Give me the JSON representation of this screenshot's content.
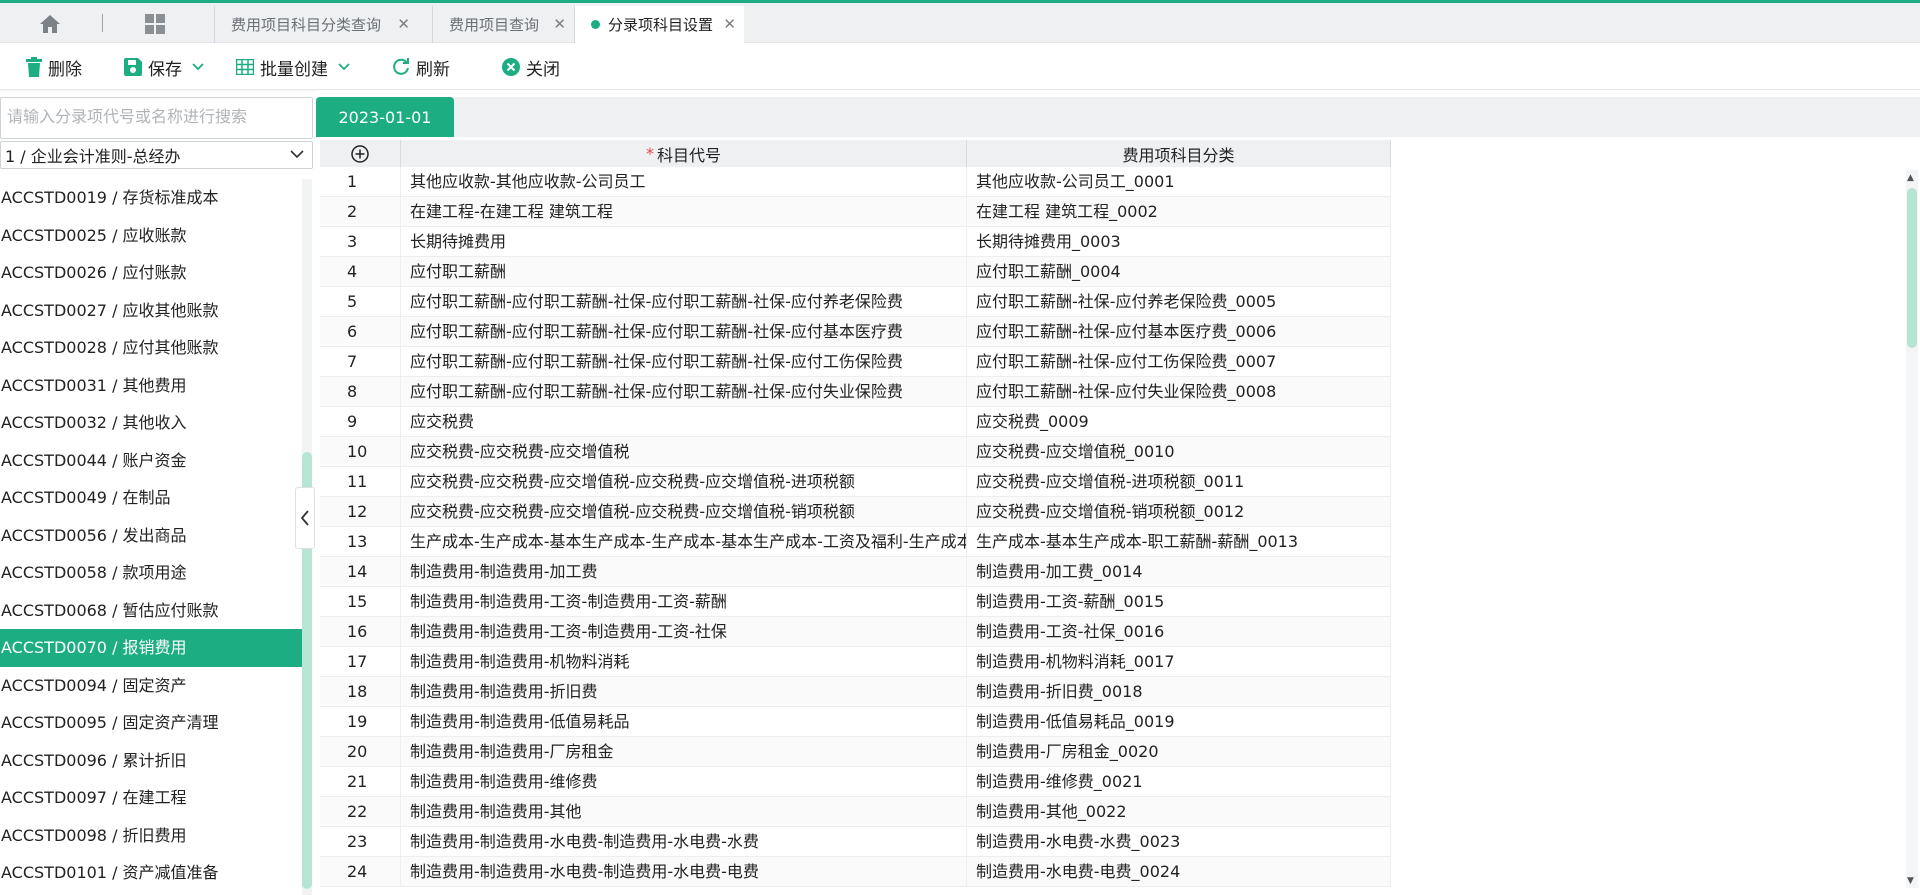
{
  "tabs": [
    {
      "label": "费用项目科目分类查询",
      "active": false
    },
    {
      "label": "费用项目查询",
      "active": false
    },
    {
      "label": "分录项科目设置",
      "active": true
    }
  ],
  "toolbar": {
    "delete_label": "删除",
    "save_label": "保存",
    "batch_create_label": "批量创建",
    "refresh_label": "刷新",
    "close_label": "关闭"
  },
  "sidebar": {
    "search_placeholder": "请输入分录项代号或名称进行搜索",
    "selected_ledger": "1 / 企业会计准则-总经办",
    "items": [
      "ACCSTD0019 / 存货标准成本",
      "ACCSTD0025 / 应收账款",
      "ACCSTD0026 / 应付账款",
      "ACCSTD0027 / 应收其他账款",
      "ACCSTD0028 / 应付其他账款",
      "ACCSTD0031 / 其他费用",
      "ACCSTD0032 / 其他收入",
      "ACCSTD0044 / 账户资金",
      "ACCSTD0049 / 在制品",
      "ACCSTD0056 / 发出商品",
      "ACCSTD0058 / 款项用途",
      "ACCSTD0068 / 暂估应付账款",
      "ACCSTD0070 / 报销费用",
      "ACCSTD0094 / 固定资产",
      "ACCSTD0095 / 固定资产清理",
      "ACCSTD0096 / 累计折旧",
      "ACCSTD0097 / 在建工程",
      "ACCSTD0098 / 折旧费用",
      "ACCSTD0101 / 资产减值准备"
    ],
    "selected_item": "ACCSTD0070 / 报销费用"
  },
  "date_tab": "2023-01-01",
  "table": {
    "columns": [
      "科目代号",
      "费用项科目分类"
    ],
    "required_marker": "*",
    "rows": [
      [
        "1",
        "其他应收款-其他应收款-公司员工",
        "其他应收款-公司员工_0001"
      ],
      [
        "2",
        "在建工程-在建工程 建筑工程",
        "在建工程 建筑工程_0002"
      ],
      [
        "3",
        "长期待摊费用",
        "长期待摊费用_0003"
      ],
      [
        "4",
        "应付职工薪酬",
        "应付职工薪酬_0004"
      ],
      [
        "5",
        "应付职工薪酬-应付职工薪酬-社保-应付职工薪酬-社保-应付养老保险费",
        "应付职工薪酬-社保-应付养老保险费_0005"
      ],
      [
        "6",
        "应付职工薪酬-应付职工薪酬-社保-应付职工薪酬-社保-应付基本医疗费",
        "应付职工薪酬-社保-应付基本医疗费_0006"
      ],
      [
        "7",
        "应付职工薪酬-应付职工薪酬-社保-应付职工薪酬-社保-应付工伤保险费",
        "应付职工薪酬-社保-应付工伤保险费_0007"
      ],
      [
        "8",
        "应付职工薪酬-应付职工薪酬-社保-应付职工薪酬-社保-应付失业保险费",
        "应付职工薪酬-社保-应付失业保险费_0008"
      ],
      [
        "9",
        "应交税费",
        "应交税费_0009"
      ],
      [
        "10",
        "应交税费-应交税费-应交增值税",
        "应交税费-应交增值税_0010"
      ],
      [
        "11",
        "应交税费-应交税费-应交增值税-应交税费-应交增值税-进项税额",
        "应交税费-应交增值税-进项税额_0011"
      ],
      [
        "12",
        "应交税费-应交税费-应交增值税-应交税费-应交增值税-销项税额",
        "应交税费-应交增值税-销项税额_0012"
      ],
      [
        "13",
        "生产成本-生产成本-基本生产成本-生产成本-基本生产成本-工资及福利-生产成本",
        "生产成本-基本生产成本-职工薪酬-薪酬_0013"
      ],
      [
        "14",
        "制造费用-制造费用-加工费",
        "制造费用-加工费_0014"
      ],
      [
        "15",
        "制造费用-制造费用-工资-制造费用-工资-薪酬",
        "制造费用-工资-薪酬_0015"
      ],
      [
        "16",
        "制造费用-制造费用-工资-制造费用-工资-社保",
        "制造费用-工资-社保_0016"
      ],
      [
        "17",
        "制造费用-制造费用-机物料消耗",
        "制造费用-机物料消耗_0017"
      ],
      [
        "18",
        "制造费用-制造费用-折旧费",
        "制造费用-折旧费_0018"
      ],
      [
        "19",
        "制造费用-制造费用-低值易耗品",
        "制造费用-低值易耗品_0019"
      ],
      [
        "20",
        "制造费用-制造费用-厂房租金",
        "制造费用-厂房租金_0020"
      ],
      [
        "21",
        "制造费用-制造费用-维修费",
        "制造费用-维修费_0021"
      ],
      [
        "22",
        "制造费用-制造费用-其他",
        "制造费用-其他_0022"
      ],
      [
        "23",
        "制造费用-制造费用-水电费-制造费用-水电费-水费",
        "制造费用-水电费-水费_0023"
      ],
      [
        "24",
        "制造费用-制造费用-水电费-制造费用-水电费-电费",
        "制造费用-水电费-电费_0024"
      ]
    ]
  },
  "colors": {
    "accent": "#1cae82",
    "required": "#e5484d"
  }
}
